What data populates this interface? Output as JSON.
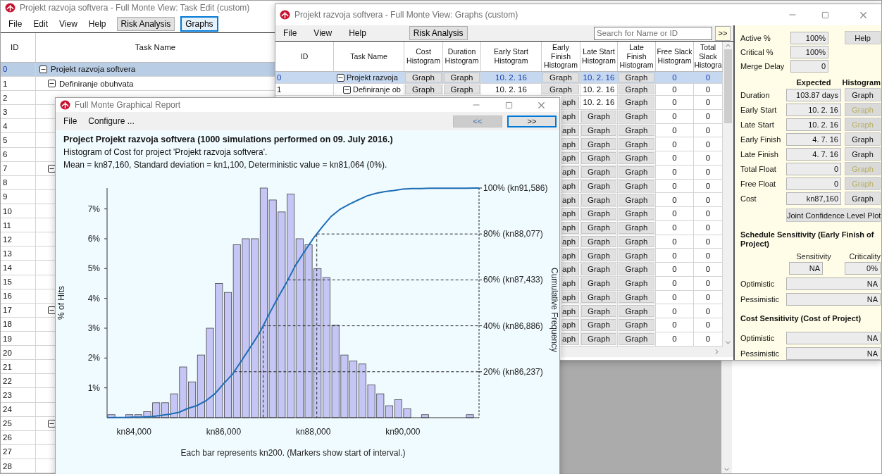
{
  "task_edit_window": {
    "title": "Projekt razvoja softvera - Full Monte View: Task Edit (custom)",
    "menu": [
      "File",
      "Edit",
      "View",
      "Help"
    ],
    "toolbar_buttons": [
      {
        "label": "Risk Analysis",
        "selected": false
      },
      {
        "label": "Graphs",
        "selected": true
      }
    ],
    "columns": [
      "ID",
      "Task Name"
    ],
    "rows": [
      {
        "number": "0",
        "task_name": "Projekt razvoja softvera",
        "expanded": true,
        "selected": true,
        "children": [
          {
            "number": "1",
            "task_name": "Definiranje obuhvata",
            "expanded": true,
            "selected": false,
            "children": [
              {
                "number": "2",
                "selected": false
              },
              {
                "number": "3",
                "selected": false
              },
              {
                "number": "4",
                "selected": false
              },
              {
                "number": "5",
                "selected": false
              },
              {
                "number": "6",
                "selected": false
              }
            ]
          },
          {
            "number": "7",
            "expanded": true,
            "selected": false,
            "children": [
              {
                "number": "8",
                "selected": false
              },
              {
                "number": "9",
                "selected": false
              },
              {
                "number": "10",
                "selected": false
              },
              {
                "number": "11",
                "selected": false
              },
              {
                "number": "12",
                "selected": false
              },
              {
                "number": "13",
                "selected": false
              },
              {
                "number": "14",
                "selected": false
              },
              {
                "number": "15",
                "selected": false
              },
              {
                "number": "16",
                "selected": false
              }
            ]
          },
          {
            "number": "17",
            "expanded": true,
            "selected": false,
            "children": [
              {
                "number": "18",
                "selected": false
              },
              {
                "number": "19",
                "selected": false
              },
              {
                "number": "20",
                "selected": false
              },
              {
                "number": "21",
                "selected": false
              },
              {
                "number": "22",
                "selected": false
              },
              {
                "number": "23",
                "selected": false
              },
              {
                "number": "24",
                "selected": false
              }
            ]
          },
          {
            "number": "25",
            "expanded": true,
            "selected": false,
            "children": [
              {
                "number": "26",
                "selected": false
              },
              {
                "number": "27",
                "selected": false
              },
              {
                "number": "28",
                "selected": false
              }
            ]
          }
        ]
      }
    ]
  },
  "graphs_window": {
    "title": "Projekt razvoja softvera - Full Monte View: Graphs (custom)",
    "menu": [
      "File",
      "View",
      "Help"
    ],
    "toolbar_buttons": [
      {
        "label": "Risk Analysis",
        "selected": false
      }
    ],
    "search": {
      "placeholder": "Search for Name or ID"
    },
    "search_button": ">>",
    "columns": [
      "ID",
      "Task Name",
      "Cost Histogram",
      "Duration Histogram",
      "Early Start Histogram",
      "Early Finish Histogram",
      "Late Start Histogram",
      "Late Finish Histogram",
      "Free Slack Histogram",
      "Total Slack Histogra"
    ],
    "rows": [
      {
        "expanded": true,
        "selected": true,
        "cells": [
          {
            "text": "0",
            "kind": "id"
          },
          {
            "text": "Projekt razvoja",
            "kind": "name"
          },
          {
            "text": "Graph",
            "kind": "button"
          },
          {
            "text": "Graph",
            "kind": "button"
          },
          {
            "text": "10. 2. 16",
            "kind": "text"
          },
          {
            "text": "Graph",
            "kind": "button"
          },
          {
            "text": "10. 2. 16",
            "kind": "text"
          },
          {
            "text": "Graph",
            "kind": "button"
          },
          {
            "text": "0",
            "kind": "text"
          },
          {
            "text": "0",
            "kind": "text"
          }
        ],
        "children": [
          {
            "expanded": true,
            "selected": false,
            "cells": [
              {
                "text": "1",
                "kind": "id"
              },
              {
                "text": "Definiranje ob",
                "kind": "name"
              },
              {
                "text": "Graph",
                "kind": "button"
              },
              {
                "text": "Graph",
                "kind": "button"
              },
              {
                "text": "10. 2. 16",
                "kind": "text"
              },
              {
                "text": "Graph",
                "kind": "button"
              },
              {
                "text": "10. 2. 16",
                "kind": "text"
              },
              {
                "text": "Graph",
                "kind": "button"
              },
              {
                "text": "0",
                "kind": "text"
              },
              {
                "text": "0",
                "kind": "text"
              }
            ],
            "children": [
              {
                "selected": false,
                "visible_cells": [
                  {
                    "text": "aph",
                    "kind": "button"
                  },
                  {
                    "text": "10. 2. 16",
                    "kind": "text"
                  },
                  {
                    "text": "Graph",
                    "kind": "button"
                  },
                  {
                    "text": "0",
                    "kind": "text"
                  },
                  {
                    "text": "0",
                    "kind": "text"
                  }
                ]
              },
              {
                "selected": false,
                "visible_cells": [
                  {
                    "text": "aph",
                    "kind": "button"
                  },
                  {
                    "text": "Graph",
                    "kind": "button"
                  },
                  {
                    "text": "Graph",
                    "kind": "button"
                  },
                  {
                    "text": "0",
                    "kind": "text"
                  },
                  {
                    "text": "0",
                    "kind": "text"
                  }
                ]
              },
              {
                "selected": false,
                "visible_cells": [
                  {
                    "text": "aph",
                    "kind": "button"
                  },
                  {
                    "text": "Graph",
                    "kind": "button"
                  },
                  {
                    "text": "Graph",
                    "kind": "button"
                  },
                  {
                    "text": "0",
                    "kind": "text"
                  },
                  {
                    "text": "0",
                    "kind": "text"
                  }
                ]
              },
              {
                "selected": false,
                "visible_cells": [
                  {
                    "text": "aph",
                    "kind": "button"
                  },
                  {
                    "text": "Graph",
                    "kind": "button"
                  },
                  {
                    "text": "Graph",
                    "kind": "button"
                  },
                  {
                    "text": "0",
                    "kind": "text"
                  },
                  {
                    "text": "0",
                    "kind": "text"
                  }
                ]
              },
              {
                "selected": false,
                "visible_cells": [
                  {
                    "text": "aph",
                    "kind": "button"
                  },
                  {
                    "text": "Graph",
                    "kind": "button"
                  },
                  {
                    "text": "Graph",
                    "kind": "button"
                  },
                  {
                    "text": "0",
                    "kind": "text"
                  },
                  {
                    "text": "0",
                    "kind": "text"
                  }
                ]
              }
            ]
          },
          {
            "selected": false,
            "visible_cells": [
              {
                "text": "aph",
                "kind": "button"
              },
              {
                "text": "Graph",
                "kind": "button"
              },
              {
                "text": "Graph",
                "kind": "button"
              },
              {
                "text": "0",
                "kind": "text"
              },
              {
                "text": "0",
                "kind": "text"
              }
            ],
            "children": [
              {
                "selected": false,
                "visible_cells": [
                  {
                    "text": "aph",
                    "kind": "button"
                  },
                  {
                    "text": "Graph",
                    "kind": "button"
                  },
                  {
                    "text": "Graph",
                    "kind": "button"
                  },
                  {
                    "text": "0",
                    "kind": "text"
                  },
                  {
                    "text": "0",
                    "kind": "text"
                  }
                ]
              },
              {
                "selected": false,
                "visible_cells": [
                  {
                    "text": "aph",
                    "kind": "button"
                  },
                  {
                    "text": "Graph",
                    "kind": "button"
                  },
                  {
                    "text": "Graph",
                    "kind": "button"
                  },
                  {
                    "text": "0",
                    "kind": "text"
                  },
                  {
                    "text": "0",
                    "kind": "text"
                  }
                ]
              },
              {
                "selected": false,
                "visible_cells": [
                  {
                    "text": "aph",
                    "kind": "button"
                  },
                  {
                    "text": "Graph",
                    "kind": "button"
                  },
                  {
                    "text": "Graph",
                    "kind": "button"
                  },
                  {
                    "text": "0",
                    "kind": "text"
                  },
                  {
                    "text": "0",
                    "kind": "text"
                  }
                ]
              },
              {
                "selected": false,
                "visible_cells": [
                  {
                    "text": "aph",
                    "kind": "button"
                  },
                  {
                    "text": "Graph",
                    "kind": "button"
                  },
                  {
                    "text": "Graph",
                    "kind": "button"
                  },
                  {
                    "text": "0",
                    "kind": "text"
                  },
                  {
                    "text": "0",
                    "kind": "text"
                  }
                ]
              },
              {
                "selected": false,
                "visible_cells": [
                  {
                    "text": "aph",
                    "kind": "button"
                  },
                  {
                    "text": "Graph",
                    "kind": "button"
                  },
                  {
                    "text": "Graph",
                    "kind": "button"
                  },
                  {
                    "text": "0",
                    "kind": "text"
                  },
                  {
                    "text": "0",
                    "kind": "text"
                  }
                ]
              },
              {
                "selected": false,
                "visible_cells": [
                  {
                    "text": "aph",
                    "kind": "button"
                  },
                  {
                    "text": "Graph",
                    "kind": "button"
                  },
                  {
                    "text": "Graph",
                    "kind": "button"
                  },
                  {
                    "text": "0",
                    "kind": "text"
                  },
                  {
                    "text": "0",
                    "kind": "text"
                  }
                ]
              },
              {
                "selected": false,
                "visible_cells": [
                  {
                    "text": "aph",
                    "kind": "button"
                  },
                  {
                    "text": "Graph",
                    "kind": "button"
                  },
                  {
                    "text": "Graph",
                    "kind": "button"
                  },
                  {
                    "text": "0",
                    "kind": "text"
                  },
                  {
                    "text": "0",
                    "kind": "text"
                  }
                ]
              },
              {
                "selected": false,
                "visible_cells": [
                  {
                    "text": "aph",
                    "kind": "button"
                  },
                  {
                    "text": "Graph",
                    "kind": "button"
                  },
                  {
                    "text": "Graph",
                    "kind": "button"
                  },
                  {
                    "text": "0",
                    "kind": "text"
                  },
                  {
                    "text": "0",
                    "kind": "text"
                  }
                ]
              },
              {
                "selected": false,
                "visible_cells": [
                  {
                    "text": "aph",
                    "kind": "button"
                  },
                  {
                    "text": "Graph",
                    "kind": "button"
                  },
                  {
                    "text": "Graph",
                    "kind": "button"
                  },
                  {
                    "text": "0",
                    "kind": "text"
                  },
                  {
                    "text": "0",
                    "kind": "text"
                  }
                ]
              }
            ]
          },
          {
            "selected": false,
            "visible_cells": [
              {
                "text": "aph",
                "kind": "button"
              },
              {
                "text": "Graph",
                "kind": "button"
              },
              {
                "text": "Graph",
                "kind": "button"
              },
              {
                "text": "0",
                "kind": "text"
              },
              {
                "text": "0",
                "kind": "text"
              }
            ],
            "children": [
              {
                "selected": false,
                "visible_cells": [
                  {
                    "text": "aph",
                    "kind": "button"
                  },
                  {
                    "text": "Graph",
                    "kind": "button"
                  },
                  {
                    "text": "Graph",
                    "kind": "button"
                  },
                  {
                    "text": "0",
                    "kind": "text"
                  },
                  {
                    "text": "0",
                    "kind": "text"
                  }
                ]
              },
              {
                "selected": false,
                "visible_cells": [
                  {
                    "text": "aph",
                    "kind": "button"
                  },
                  {
                    "text": "Graph",
                    "kind": "button"
                  },
                  {
                    "text": "Graph",
                    "kind": "button"
                  },
                  {
                    "text": "0",
                    "kind": "text"
                  },
                  {
                    "text": "0",
                    "kind": "text"
                  }
                ]
              }
            ]
          }
        ]
      }
    ],
    "side_panel": {
      "top_fields": [
        {
          "label": "Active %",
          "value": "100%"
        },
        {
          "label": "Critical %",
          "value": "100%"
        },
        {
          "label": "Merge Delay",
          "value": "0"
        }
      ],
      "help_button": "Help",
      "expected_header": "Expected",
      "histogram_header": "Histogram",
      "metrics": [
        {
          "label": "Duration",
          "value": "103.87 days",
          "button": "Graph",
          "disabled": false
        },
        {
          "label": "Early Start",
          "value": "10. 2. 16",
          "button": "Graph",
          "disabled": true
        },
        {
          "label": "Late Start",
          "value": "10. 2. 16",
          "button": "Graph",
          "disabled": true
        },
        {
          "label": "Early Finish",
          "value": "4. 7. 16",
          "button": "Graph",
          "disabled": false
        },
        {
          "label": "Late Finish",
          "value": "4. 7. 16",
          "button": "Graph",
          "disabled": false
        },
        {
          "label": "Total Float",
          "value": "0",
          "button": "Graph",
          "disabled": true
        },
        {
          "label": "Free Float",
          "value": "0",
          "button": "Graph",
          "disabled": true
        },
        {
          "label": "Cost",
          "value": "kn87,160",
          "button": "Graph",
          "disabled": false
        }
      ],
      "joint_button": "Joint Confidence Level Plot",
      "schedule_sensitivity": {
        "title": "Schedule Sensitivity (Early Finish of Project)",
        "sensitivity_label": "Sensitivity",
        "criticality_label": "Criticality",
        "sensitivity_value": "NA",
        "criticality_value": "0%",
        "rows": [
          {
            "label": "Optimistic",
            "value": "NA"
          },
          {
            "label": "Pessimistic",
            "value": "NA"
          }
        ]
      },
      "cost_sensitivity": {
        "title": "Cost Sensitivity (Cost of Project)",
        "rows": [
          {
            "label": "Optimistic",
            "value": "NA"
          },
          {
            "label": "Pessimistic",
            "value": "NA"
          }
        ]
      }
    }
  },
  "report_window": {
    "title": "Full Monte Graphical Report",
    "menu": [
      "File",
      "Configure ..."
    ],
    "nav_buttons": [
      {
        "label": "<<",
        "disabled": true
      },
      {
        "label": ">>",
        "disabled": false
      }
    ],
    "heading": "Project Projekt razvoja softvera (1000 simulations performed on 09. July 2016.)",
    "subtitle": "Histogram of Cost for project 'Projekt razvoja softvera'.",
    "stats": "Mean = kn87,160, Standard deviation = kn1,100, Deterministic value = kn81,064 (0%).",
    "secondary_axis_title": "Cumulative Frequency",
    "chart_data": {
      "type": "bar",
      "xlabel": "Each bar represents kn200. (Markers show start of interval.)",
      "categories": [
        null,
        null,
        null,
        "kn84,000",
        null,
        null,
        null,
        null,
        null,
        null,
        null,
        null,
        null,
        "kn86,000",
        null,
        null,
        null,
        null,
        null,
        null,
        null,
        null,
        null,
        "kn88,000",
        null,
        null,
        null,
        null,
        null,
        null,
        null,
        null,
        null,
        "kn90,000",
        null,
        null,
        null,
        null,
        null,
        null,
        null
      ],
      "series": [
        {
          "name": "% of Hits",
          "color": "#c6c6f6",
          "values": [
            0.1,
            0,
            0.1,
            0.1,
            0.2,
            0.5,
            0.5,
            0.8,
            1.7,
            1.2,
            2.1,
            3.0,
            4.5,
            4.2,
            5.8,
            6.0,
            6.0,
            7.7,
            7.3,
            6.9,
            7.5,
            6.0,
            5.8,
            5.0,
            4.7,
            3.1,
            2.1,
            1.9,
            1.8,
            1.1,
            0.8,
            0.4,
            0.6,
            0.3,
            0,
            0.1,
            0,
            0,
            0,
            0,
            0.1
          ]
        }
      ],
      "ylim": [
        0,
        7.7
      ],
      "yticks": [
        {
          "value": 1,
          "label": "1%"
        },
        {
          "value": 2,
          "label": "2%"
        },
        {
          "value": 3,
          "label": "3%"
        },
        {
          "value": 4,
          "label": "4%"
        },
        {
          "value": 5,
          "label": "5%"
        },
        {
          "value": 6,
          "label": "6%"
        },
        {
          "value": 7,
          "label": "7%"
        }
      ],
      "annotations": [
        "100% (kn91,586)",
        "80% (kn88,077)",
        "60% (kn87,433)",
        "40% (kn86,886)",
        "20% (kn86,237)"
      ]
    }
  }
}
